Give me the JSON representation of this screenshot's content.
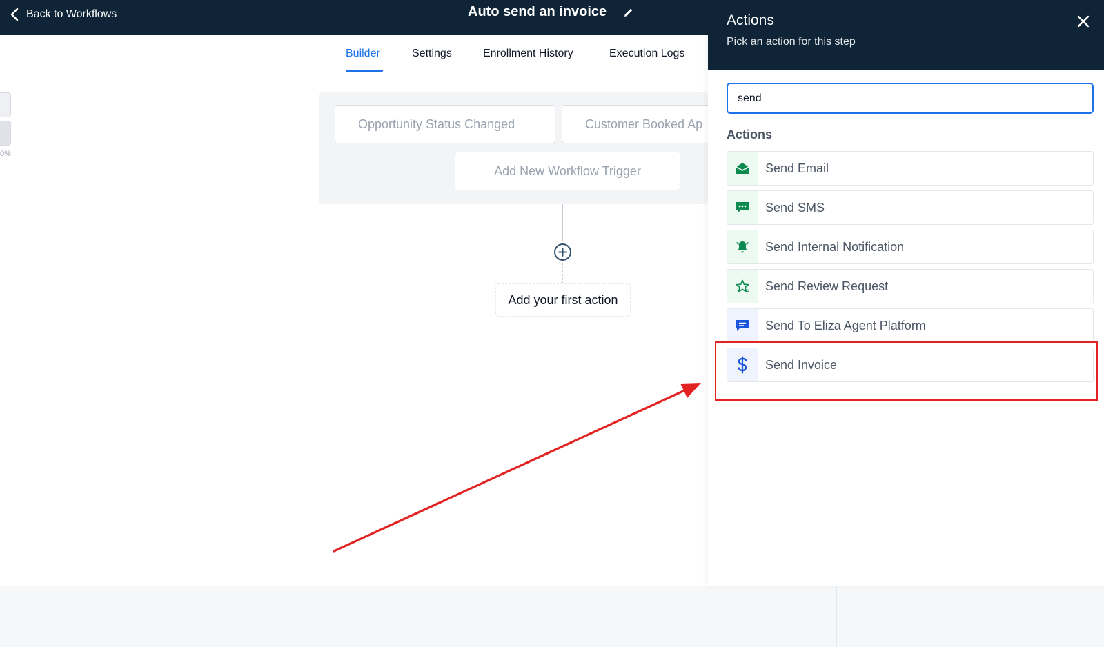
{
  "header": {
    "back_label": "Back to Workflows",
    "workflow_title": "Auto send an invoice"
  },
  "tabs": [
    {
      "label": "Builder",
      "active": true
    },
    {
      "label": "Settings",
      "active": false
    },
    {
      "label": "Enrollment History",
      "active": false
    },
    {
      "label": "Execution Logs",
      "active": false
    }
  ],
  "canvas": {
    "zoom_text": "0%",
    "triggers": [
      "Opportunity Status Changed",
      "Customer Booked Ap"
    ],
    "add_trigger_label": "Add New Workflow Trigger",
    "first_action_label": "Add your first action"
  },
  "drawer": {
    "title": "Actions",
    "subtitle": "Pick an action for this step",
    "search_value": "send",
    "section_label": "Actions",
    "actions": [
      {
        "label": "Send Email",
        "icon": "envelope-icon"
      },
      {
        "label": "Send SMS",
        "icon": "chat-icon"
      },
      {
        "label": "Send Internal Notification",
        "icon": "bell-icon"
      },
      {
        "label": "Send Review Request",
        "icon": "star-icon"
      },
      {
        "label": "Send To Eliza Agent Platform",
        "icon": "message-icon"
      },
      {
        "label": "Send Invoice",
        "icon": "dollar-icon"
      }
    ]
  },
  "colors": {
    "header_bg": "#0f2537",
    "accent_blue": "#1a73e8",
    "icon_green": "#0d8a4f",
    "annotation_red": "#e32222"
  }
}
